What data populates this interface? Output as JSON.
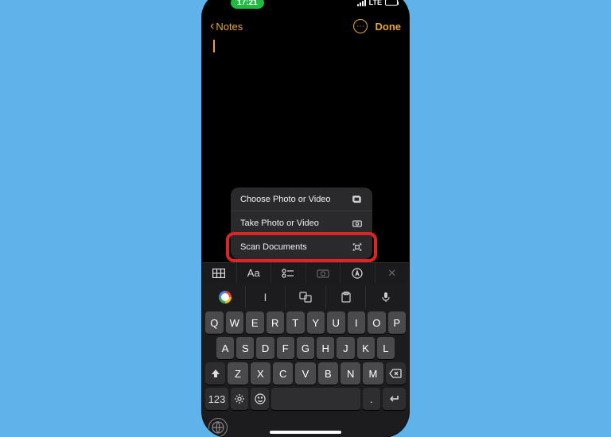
{
  "status": {
    "time": "17:21",
    "carrier": "LTE"
  },
  "nav": {
    "back": "Notes",
    "done": "Done"
  },
  "menu": {
    "choose": "Choose Photo or Video",
    "take": "Take Photo or Video",
    "scan": "Scan Documents"
  },
  "toolbar": {
    "format": "Aa"
  },
  "suggestions": {
    "pipe": "I"
  },
  "keys": {
    "r1": [
      "Q",
      "W",
      "E",
      "R",
      "T",
      "Y",
      "U",
      "I",
      "O",
      "P"
    ],
    "r2": [
      "A",
      "S",
      "D",
      "F",
      "G",
      "H",
      "J",
      "K",
      "L"
    ],
    "r3": [
      "Z",
      "X",
      "C",
      "V",
      "B",
      "N",
      "M"
    ],
    "num": "123",
    "ret": "↵"
  }
}
